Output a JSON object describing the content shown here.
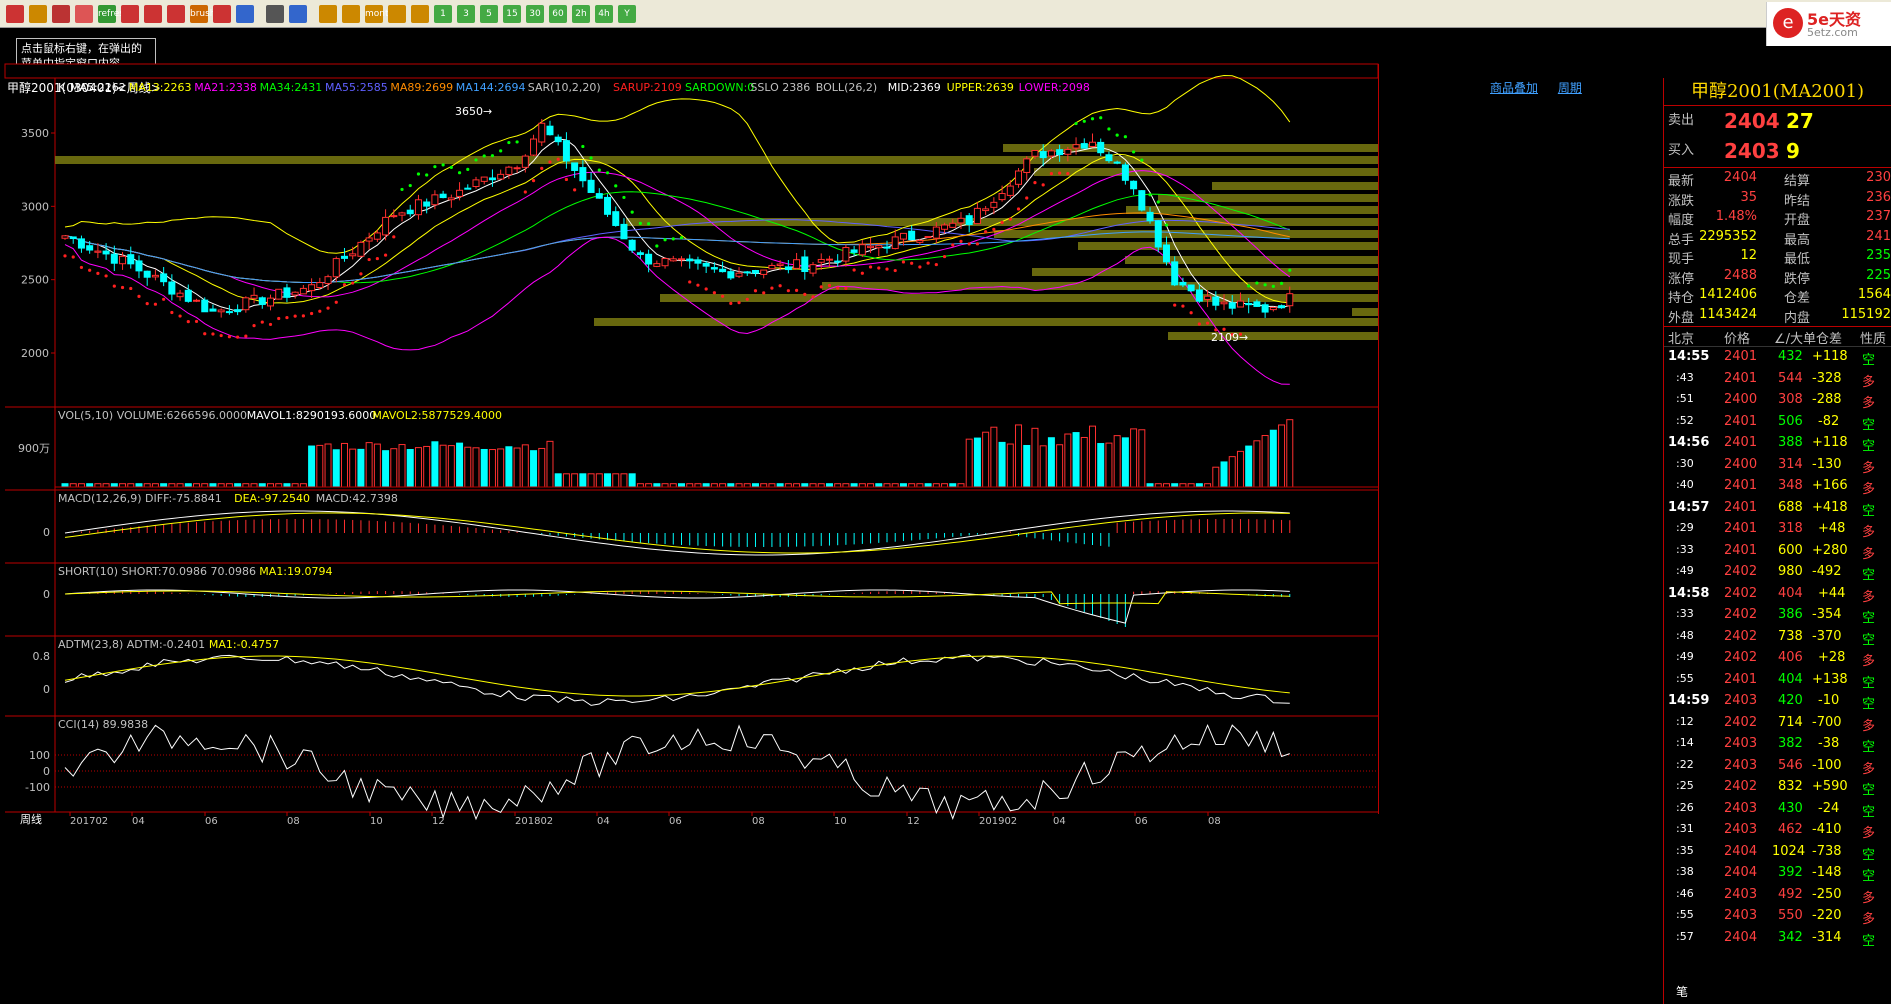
{
  "toolbar": {
    "buttons": [
      "home",
      "file",
      "book",
      "tv",
      "refresh",
      "zoom-in",
      "zoom-out",
      "draw",
      "brush",
      "filter",
      "new",
      "table",
      "chart",
      "day",
      "week",
      "month",
      "season",
      "year",
      "1",
      "3",
      "5",
      "15",
      "30",
      "60",
      "2h",
      "4h",
      "Y"
    ]
  },
  "tip": "点击鼠标右键，在弹出的菜单中指定窗口内容。",
  "logo": {
    "brand": "5e天资",
    "site": "5etz.com"
  },
  "chart": {
    "label": "甲醇2001(030401)<周线>",
    "links": [
      "商品叠加",
      "周期"
    ],
    "title_k": "K",
    "ma": [
      {
        "t": "MA5:2262",
        "c": "#ffffff"
      },
      {
        "t": "MA13:2263",
        "c": "#ffff00"
      },
      {
        "t": "MA21:2338",
        "c": "#ff00ff"
      },
      {
        "t": "MA34:2431",
        "c": "#00ff00"
      },
      {
        "t": "MA55:2585",
        "c": "#6060ff"
      },
      {
        "t": "MA89:2699",
        "c": "#ff8c00"
      },
      {
        "t": "MA144:2694",
        "c": "#40a0ff"
      },
      {
        "t": "SAR(10,2,20)",
        "c": "#c0c0c0"
      },
      {
        "t": "SARUP:2109",
        "c": "#ff2020"
      },
      {
        "t": "SARDOWN:0",
        "c": "#00ff00"
      },
      {
        "t": "SSLO 2386",
        "c": "#c0c0c0"
      },
      {
        "t": "BOLL(26,2)",
        "c": "#c0c0c0"
      },
      {
        "t": "MID:2369",
        "c": "#ffffff"
      },
      {
        "t": "UPPER:2639",
        "c": "#ffff00"
      },
      {
        "t": "LOWER:2098",
        "c": "#ff00ff"
      }
    ],
    "yticks": [
      "3500",
      "3000",
      "2500",
      "2000"
    ],
    "high_label": "3650",
    "low_label": "2109",
    "vol": {
      "title": [
        {
          "t": "VOL(5,10) VOLUME:6266596.0000",
          "c": "#c0c0c0"
        },
        {
          "t": "MAVOL1:8290193.6000",
          "c": "#ffffff"
        },
        {
          "t": "MAVOL2:5877529.4000",
          "c": "#ffff00"
        }
      ],
      "ytick": "900万"
    },
    "macd": {
      "title": [
        {
          "t": "MACD(12,26,9) DIFF:-75.8841",
          "c": "#c0c0c0"
        },
        {
          "t": "DEA:-97.2540",
          "c": "#ffff00"
        },
        {
          "t": "MACD:42.7398",
          "c": "#c0c0c0"
        }
      ],
      "ytick": "0"
    },
    "short": {
      "title": [
        {
          "t": "SHORT(10) SHORT:70.0986 70.0986",
          "c": "#c0c0c0"
        },
        {
          "t": "MA1:19.0794",
          "c": "#ffff00"
        }
      ],
      "ytick": "0"
    },
    "adtm": {
      "title": [
        {
          "t": "ADTM(23,8) ADTM:-0.2401",
          "c": "#c0c0c0"
        },
        {
          "t": "MA1:-0.4757",
          "c": "#ffff00"
        }
      ],
      "yticks": [
        "0.8",
        "0"
      ]
    },
    "cci": {
      "title": [
        {
          "t": "CCI(14) 89.9838",
          "c": "#c0c0c0"
        }
      ],
      "yticks": [
        "100",
        "0",
        "-100"
      ]
    },
    "xaxis": {
      "label": "周线",
      "ticks": [
        "201702",
        "04",
        "06",
        "08",
        "10",
        "12",
        "201802",
        "04",
        "06",
        "08",
        "10",
        "12",
        "201902",
        "04",
        "06",
        "08"
      ]
    }
  },
  "panel": {
    "title": "甲醇2001(MA2001)",
    "ask": {
      "label": "卖出",
      "price": "2404",
      "vol": "27"
    },
    "bid": {
      "label": "买入",
      "price": "2403",
      "vol": "9"
    },
    "stats": [
      [
        "最新",
        "2404",
        "结算",
        "230"
      ],
      [
        "涨跌",
        "35",
        "昨结",
        "236"
      ],
      [
        "幅度",
        "1.48%",
        "开盘",
        "237"
      ],
      [
        "总手",
        "2295352",
        "最高",
        "241"
      ],
      [
        "现手",
        "12",
        "最低",
        "235"
      ],
      [
        "涨停",
        "2488",
        "跌停",
        "225"
      ],
      [
        "持仓",
        "1412406",
        "仓差",
        "1564"
      ],
      [
        "外盘",
        "1143424",
        "内盘",
        "115192"
      ]
    ],
    "ticks_header": [
      "北京",
      "价格",
      "∠/大单",
      "仓差",
      "性质"
    ],
    "ticks": [
      [
        "14:55",
        "2401",
        "432",
        "+118",
        "空"
      ],
      [
        ":43",
        "2401",
        "544",
        "-328",
        "多"
      ],
      [
        ":51",
        "2400",
        "308",
        "-288",
        "多"
      ],
      [
        ":52",
        "2401",
        "506",
        "-82",
        "空"
      ],
      [
        "14:56",
        "2401",
        "388",
        "+118",
        "空"
      ],
      [
        ":30",
        "2400",
        "314",
        "-130",
        "多"
      ],
      [
        ":40",
        "2401",
        "348",
        "+166",
        "多"
      ],
      [
        "14:57",
        "2401",
        "688",
        "+418",
        "空"
      ],
      [
        ":29",
        "2401",
        "318",
        "+48",
        "多"
      ],
      [
        ":33",
        "2401",
        "600",
        "+280",
        "多"
      ],
      [
        ":49",
        "2402",
        "980",
        "-492",
        "空"
      ],
      [
        "14:58",
        "2402",
        "404",
        "+44",
        "多"
      ],
      [
        ":33",
        "2402",
        "386",
        "-354",
        "空"
      ],
      [
        ":48",
        "2402",
        "738",
        "-370",
        "空"
      ],
      [
        ":49",
        "2402",
        "406",
        "+28",
        "多"
      ],
      [
        ":55",
        "2401",
        "404",
        "+138",
        "空"
      ],
      [
        "14:59",
        "2403",
        "420",
        "-10",
        "空"
      ],
      [
        ":12",
        "2402",
        "714",
        "-700",
        "多"
      ],
      [
        ":14",
        "2403",
        "382",
        "-38",
        "空"
      ],
      [
        ":22",
        "2403",
        "546",
        "-100",
        "多"
      ],
      [
        ":25",
        "2402",
        "832",
        "+590",
        "空"
      ],
      [
        ":26",
        "2403",
        "430",
        "-24",
        "空"
      ],
      [
        ":31",
        "2403",
        "462",
        "-410",
        "多"
      ],
      [
        ":35",
        "2404",
        "1024",
        "-738",
        "空"
      ],
      [
        ":38",
        "2404",
        "392",
        "-148",
        "空"
      ],
      [
        ":46",
        "2403",
        "492",
        "-250",
        "多"
      ],
      [
        ":55",
        "2403",
        "550",
        "-220",
        "多"
      ],
      [
        ":57",
        "2404",
        "342",
        "-314",
        "空"
      ]
    ],
    "footer": "笔"
  }
}
